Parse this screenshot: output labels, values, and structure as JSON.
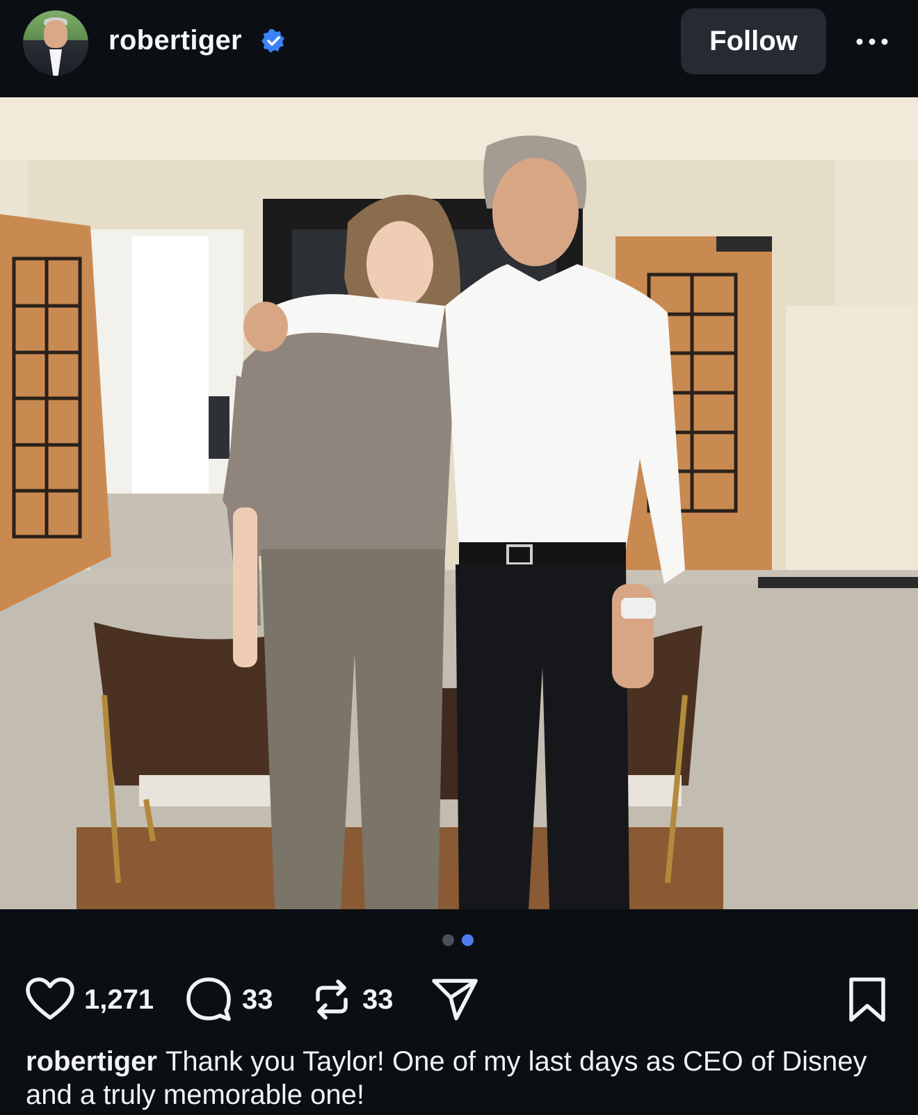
{
  "header": {
    "username": "robertiger",
    "verified": true,
    "follow_label": "Follow",
    "avatar_icon": "profile-avatar",
    "more_icon": "more-options-icon"
  },
  "post": {
    "image_alt": "Photo of two people posing together in an office",
    "carousel": {
      "total": 2,
      "active": 2
    }
  },
  "actions": {
    "likes": "1,271",
    "comments": "33",
    "reposts": "33",
    "icons": [
      "heart-icon",
      "comment-icon",
      "repost-icon",
      "share-icon",
      "bookmark-icon"
    ]
  },
  "caption": {
    "username": "robertiger",
    "text": "Thank you Taylor! One of my last days as CEO of Disney and a truly memorable one!"
  },
  "colors": {
    "background": "#0b0f14",
    "button_bg": "#262b33",
    "verified_blue": "#3b82f6",
    "dot_active": "#4f7df0",
    "dot_inactive": "#4b5058"
  }
}
